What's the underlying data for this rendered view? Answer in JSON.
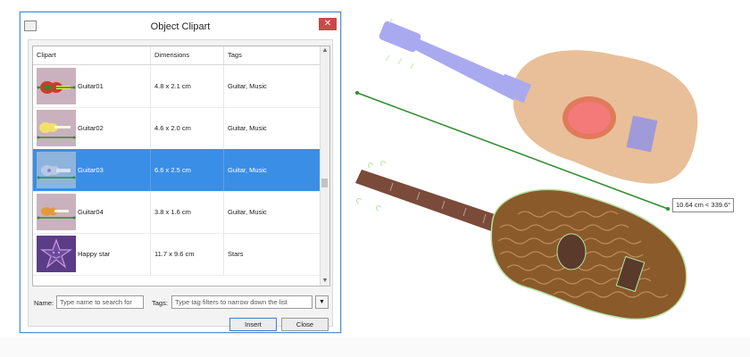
{
  "dialog": {
    "title": "Object Clipart",
    "close_glyph": "✕",
    "columns": {
      "clipart": "Clipart",
      "dimensions": "Dimensions",
      "tags": "Tags"
    },
    "rows": [
      {
        "name": "Guitar01",
        "dimensions": "4.8 x 2.1 cm",
        "tags": "Guitar, Music",
        "selected": false
      },
      {
        "name": "Guitar02",
        "dimensions": "4.6 x 2.0 cm",
        "tags": "Guitar, Music",
        "selected": false
      },
      {
        "name": "Guitar03",
        "dimensions": "6.6 x 2.5 cm",
        "tags": "Guitar, Music",
        "selected": true
      },
      {
        "name": "Guitar04",
        "dimensions": "3.8 x 1.6 cm",
        "tags": "Guitar, Music",
        "selected": false
      },
      {
        "name": "Happy star",
        "dimensions": "11.7 x 9.6 cm",
        "tags": "Stars",
        "selected": false
      }
    ],
    "name_label": "Name:",
    "name_placeholder": "Type name to search for",
    "tags_label": "Tags:",
    "tags_placeholder": "Type tag filters to narrow down the list",
    "dropdown_glyph": "▼",
    "insert_label": "Insert",
    "close_label": "Close",
    "scroll_up": "▲",
    "scroll_down": "▼"
  },
  "canvas": {
    "measurement": "10.64 cm < 339.6°",
    "measure_line_color": "#2e8b2e",
    "guitar_top_body_color": "#e8bf98",
    "guitar_top_neck_color": "#a9a9f0",
    "guitar_bottom_color": "#8a5a2b"
  }
}
